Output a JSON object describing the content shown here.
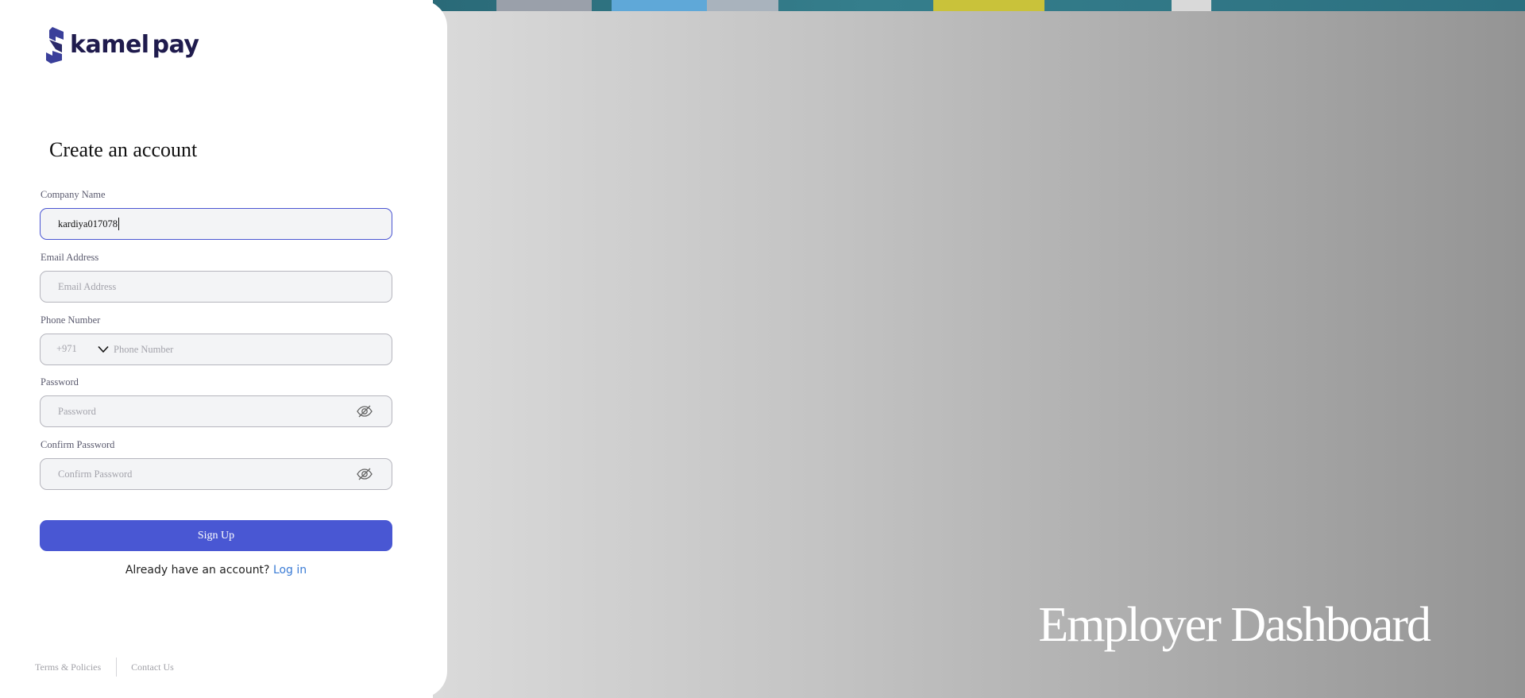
{
  "brand": {
    "name_part1": "kamel",
    "name_part2": "pay",
    "logo_icon": "kamelpay-logo-icon"
  },
  "form": {
    "title": "Create an account",
    "company_name": {
      "label": "Company Name",
      "value": "kardiya017078",
      "placeholder": "Company Name"
    },
    "email": {
      "label": "Email Address",
      "value": "",
      "placeholder": "Email Address"
    },
    "phone": {
      "label": "Phone Number",
      "country_code": "+971",
      "value": "",
      "placeholder": "Phone Number"
    },
    "password": {
      "label": "Password",
      "value": "",
      "placeholder": "Password"
    },
    "confirm_password": {
      "label": "Confirm Password",
      "value": "",
      "placeholder": "Confirm Password"
    },
    "submit_label": "Sign Up"
  },
  "login_prompt": {
    "text": "Already have an account?",
    "link_label": "Log in"
  },
  "footer": {
    "terms_label": "Terms & Policies",
    "contact_label": "Contact Us"
  },
  "hero": {
    "title": "Employer Dashboard"
  },
  "colors": {
    "accent": "#4957d3",
    "brand_dark": "#1f1b4d",
    "link": "#3a7bd5"
  }
}
